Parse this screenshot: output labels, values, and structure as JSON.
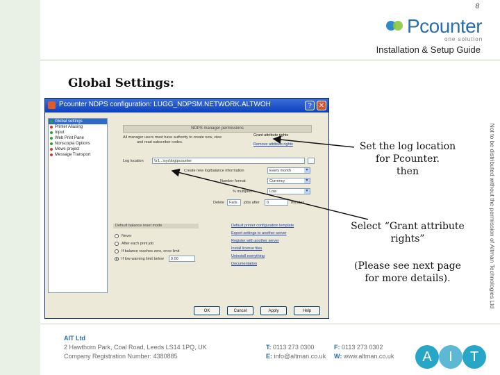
{
  "page_number": "8",
  "logo": {
    "name": "Pcounter",
    "tagline": "one solution"
  },
  "guide_title": "Installation & Setup Guide",
  "section_title": "Global Settings:",
  "dialog": {
    "title": "Pcounter NDPS configuration: LUGG_NDPSM.NETWORK.ALTWOH",
    "tree_items": [
      {
        "label": "Global settings",
        "color": "#2ea02e"
      },
      {
        "label": "Printer Aliasing",
        "color": "#d23a2a"
      },
      {
        "label": "Input",
        "color": "#2ea02e"
      },
      {
        "label": "Web Print Pane",
        "color": "#2ea02e"
      },
      {
        "label": "Nonscopia Options",
        "color": "#2ea02e"
      },
      {
        "label": "Mews project",
        "color": "#d23a2a"
      },
      {
        "label": "Message Transport",
        "color": "#d23a2a"
      }
    ],
    "group_header": "NDPS manager permissions",
    "perm_text_1": "All manager users must have authority to create new, view",
    "perm_text_2": "and read subscriber codes.",
    "grant_rights_label": "Grant attribute rights",
    "remove_rights_label": "Remove attribute rights",
    "log_location_label": "Log location",
    "log_location_value": "\\\\r1...\\sys\\log\\pcounter",
    "rows": [
      {
        "label": "Create new log/balance information",
        "value": "Every month"
      },
      {
        "label": "Number format",
        "value": "Currency"
      },
      {
        "label": "% multiplier",
        "value": "Low"
      }
    ],
    "delete_label": "Delete",
    "delete_value": "Fails",
    "jobs_after_label": "jobs after",
    "jobs_after_value": "0",
    "minutes_label": "minutes",
    "sub_header": "Default balance reset mode",
    "radio_options": [
      {
        "label": "Never",
        "on": false
      },
      {
        "label": "After each print job",
        "on": false
      },
      {
        "label": "If balance reaches zero, once limit",
        "on": false
      },
      {
        "label": "If low warning limit below",
        "on": true
      }
    ],
    "radio_value": "0.00",
    "links": [
      "Default printer configuration template",
      "Export settings to another server",
      "Register with another server",
      "Install license files",
      "Uninstall everything",
      "Documentation"
    ],
    "buttons": [
      "OK",
      "Cancel",
      "Apply",
      "Help"
    ]
  },
  "annotation_1": [
    "Set the log location",
    "for Pcounter.",
    "then"
  ],
  "annotation_2": [
    "Select “Grant attribute",
    "rights”"
  ],
  "annotation_3": [
    "(Please see next page",
    "for more details)."
  ],
  "vertical_notice": "Not to be distributed without the permission of Altman Technologies Ltd",
  "footer": {
    "company": "AIT Ltd",
    "address": "2 Hawthorn Park, Coal Road, Leeds LS14 1PQ, UK",
    "registration": "Company Registration Number: 4380885",
    "tel_label": "T:",
    "tel": "0113 273 0300",
    "fax_label": "F:",
    "fax": "0113 273 0302",
    "email_label": "E:",
    "email": "info@altman.co.uk",
    "web_label": "W:",
    "web": "www.altman.co.uk"
  },
  "ait_logo": [
    "A",
    "I",
    "T"
  ]
}
